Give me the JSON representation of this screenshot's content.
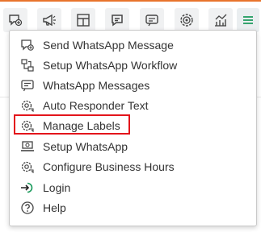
{
  "colors": {
    "accent_bar": "#e8742c",
    "menu_icon": "#1a9a5c",
    "highlight": "#e3141b",
    "text": "#333333"
  },
  "toolbar": {
    "buttons": [
      {
        "icon": "chat-add-icon"
      },
      {
        "icon": "megaphone-icon"
      },
      {
        "icon": "layout-icon"
      },
      {
        "icon": "chat-bubble-icon"
      },
      {
        "icon": "message-list-icon"
      },
      {
        "icon": "target-gear-icon"
      },
      {
        "icon": "analytics-icon"
      },
      {
        "icon": "hamburger-menu-icon"
      }
    ]
  },
  "menu": {
    "items": [
      {
        "label": "Send WhatsApp Message",
        "icon": "send-message-icon"
      },
      {
        "label": "Setup WhatsApp Workflow",
        "icon": "workflow-icon"
      },
      {
        "label": "WhatsApp Messages",
        "icon": "messages-icon"
      },
      {
        "label": "Auto Responder Text",
        "icon": "gear-chat-icon"
      },
      {
        "label": "Manage Labels",
        "icon": "gear-chat-icon",
        "highlighted": true
      },
      {
        "label": "Setup WhatsApp",
        "icon": "laptop-icon"
      },
      {
        "label": "Configure Business Hours",
        "icon": "gear-chat-icon"
      },
      {
        "label": "Login",
        "icon": "login-icon"
      },
      {
        "label": "Help",
        "icon": "help-icon"
      }
    ]
  }
}
